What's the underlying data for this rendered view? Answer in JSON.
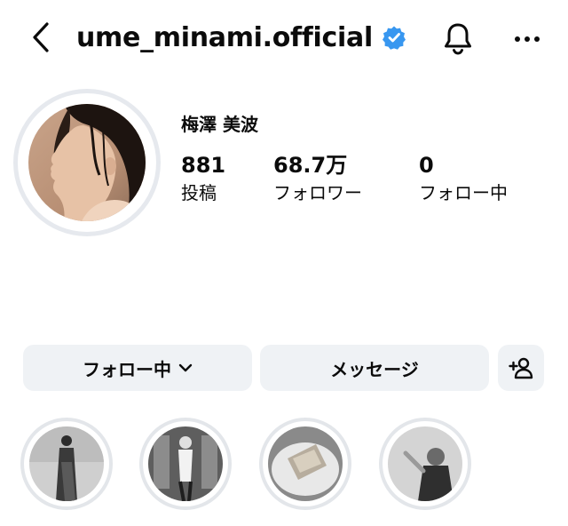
{
  "header": {
    "username": "ume_minami.official",
    "icons": {
      "back": "chevron-left-icon",
      "verified": "verified-badge-icon",
      "notifications": "bell-icon",
      "more": "more-horizontal-icon"
    }
  },
  "profile": {
    "display_name": "梅澤 美波",
    "stats": [
      {
        "value": "881",
        "label": "投稿"
      },
      {
        "value": "68.7万",
        "label": "フォロワー"
      },
      {
        "value": "0",
        "label": "フォロー中"
      }
    ]
  },
  "actions": {
    "following_label": "フォロー中",
    "message_label": "メッセージ",
    "add_friend_icon": "add-person-icon"
  },
  "colors": {
    "verified_blue": "#3897f0",
    "button_bg": "#eff2f5",
    "ring_gray": "#e3e6ea",
    "text": "#0b0b0b"
  }
}
